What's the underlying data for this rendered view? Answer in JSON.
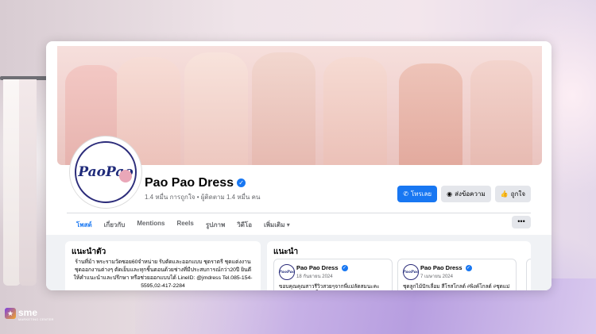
{
  "page": {
    "name": "Pao Pao Dress",
    "avatar_logo_text": "PaoPao",
    "meta": "1.4 หมื่น การถูกใจ • ผู้ติดตาม 1.4 หมื่น คน",
    "verified_icon": "verified-badge-icon"
  },
  "actions": {
    "call": "โทรเลย",
    "message": "ส่งข้อความ",
    "like": "ถูกใจ"
  },
  "tabs": [
    "โพสต์",
    "เกี่ยวกับ",
    "Mentions",
    "Reels",
    "รูปภาพ",
    "วิดีโอ",
    "เพิ่มเติม"
  ],
  "more_button": "•••",
  "intro": {
    "title": "แนะนำตัว",
    "text": "ร้านที่ม้า พระรามวัดซอย60จำหน่าย รับตัดและออกแบบ ชุดราตรี ชุดแต่งงาน ชุดออกงานต่างๆ ตัดเย็บและทุกชิ้นตอนด้วยช่างที่มีประสบการณ์กว่า20ปี ยินดีให้คำแนะนำและปรึกษา หรือช่วยออกแบบได้ LineID: @jmdress Tel.085-154-5595,02-417-2284"
  },
  "featured": {
    "title": "แนะนำ",
    "posts": [
      {
        "name": "Pao Pao Dress",
        "date": "18 กันยายน 2024",
        "text": "ขอบคุณคุณสาวรีวิวสวยๆจากพี่แม่ลัดสมนะคะ ❤️ปีงามสำหรับเนื้อไทรัก..."
      },
      {
        "name": "Pao Pao Dress",
        "date": "7 เมษายน 2024",
        "text": "ชุดลูกไม้ปักเลื่อม สีโรสโกลด์ #พิงค์โกลด์ #ชุดแม่เจ้าสาว #สวยหรูหรา สไปได้วัน..."
      }
    ]
  },
  "watermark": {
    "brand": "sme",
    "sub": "MARKETING CENTER"
  },
  "colors": {
    "accent": "#1877f2",
    "verified": "#1877f2",
    "logo": "#1f2a7a"
  }
}
